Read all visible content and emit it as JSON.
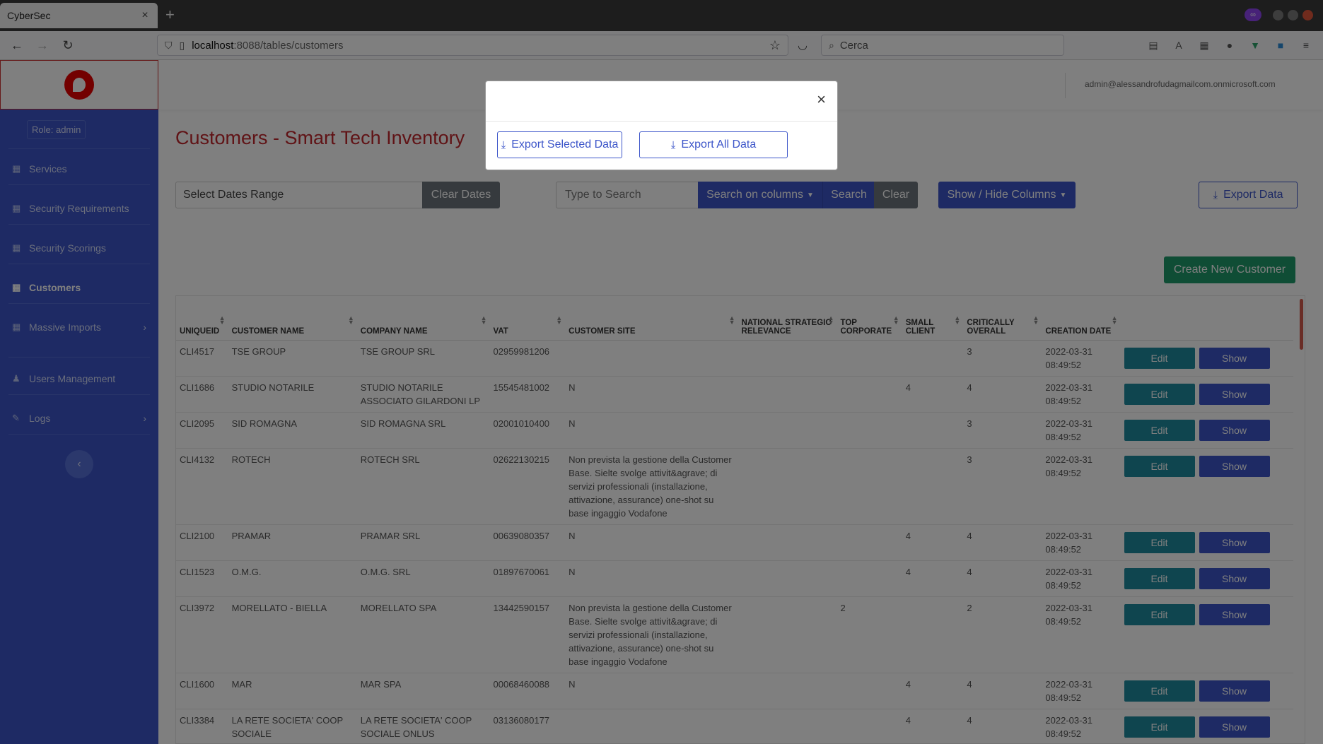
{
  "browser": {
    "tab_title": "CyberSec",
    "tab_close": "×",
    "new_tab": "+",
    "url_host": "localhost",
    "url_path": ":8088/tables/customers",
    "search_placeholder": "Cerca"
  },
  "sidebar": {
    "role": "Role: admin",
    "items": [
      {
        "label": "Services",
        "icon": "table-icon"
      },
      {
        "label": "Security Requirements",
        "icon": "table-icon"
      },
      {
        "label": "Security Scorings",
        "icon": "table-icon"
      },
      {
        "label": "Customers",
        "icon": "table-icon",
        "active": true
      },
      {
        "label": "Massive Imports",
        "icon": "table-icon",
        "chevron": "›"
      },
      {
        "label": "Users Management",
        "icon": "users-icon"
      },
      {
        "label": "Logs",
        "icon": "wrench-icon",
        "chevron": "›"
      }
    ],
    "collapse": "‹"
  },
  "topbar": {
    "user": "admin@alessandrofudagmailcom.onmicrosoft.com"
  },
  "page": {
    "title": "Customers - Smart Tech Inventory",
    "date_placeholder": "Select Dates Range",
    "clear_dates": "Clear Dates",
    "search_placeholder": "Type to Search",
    "search_columns": "Search on columns",
    "search": "Search",
    "clear": "Clear",
    "show_hide": "Show / Hide Columns",
    "export_data": "Export Data",
    "create_new": "Create New Customer"
  },
  "table": {
    "headers": [
      "UNIQUEID",
      "CUSTOMER NAME",
      "COMPANY NAME",
      "VAT",
      "CUSTOMER SITE",
      "NATIONAL STRATEGIC RELEVANCE",
      "TOP CORPORATE",
      "SMALL CLIENT",
      "CRITICALLY OVERALL",
      "CREATION DATE"
    ],
    "edit_label": "Edit",
    "show_label": "Show",
    "rows": [
      {
        "id": "CLI4517",
        "customer": "TSE GROUP",
        "company": "TSE GROUP SRL",
        "vat": "02959981206",
        "site": "",
        "nsr": "",
        "top": "",
        "small": "",
        "crit": "3",
        "date": "2022-03-31 08:49:52"
      },
      {
        "id": "CLI1686",
        "customer": "STUDIO NOTARILE",
        "company": "STUDIO NOTARILE ASSOCIATO GILARDONI LP",
        "vat": "15545481002",
        "site": "N",
        "nsr": "",
        "top": "",
        "small": "4",
        "crit": "4",
        "date": "2022-03-31 08:49:52"
      },
      {
        "id": "CLI2095",
        "customer": "SID ROMAGNA",
        "company": "SID ROMAGNA SRL",
        "vat": "02001010400",
        "site": "N",
        "nsr": "",
        "top": "",
        "small": "",
        "crit": "3",
        "date": "2022-03-31 08:49:52"
      },
      {
        "id": "CLI4132",
        "customer": "ROTECH",
        "company": "ROTECH SRL",
        "vat": "02622130215",
        "site": "Non prevista la gestione della Customer Base. Sielte svolge attivit&agrave; di servizi professionali (installazione, attivazione, assurance) one-shot su base ingaggio Vodafone",
        "nsr": "",
        "top": "",
        "small": "",
        "crit": "3",
        "date": "2022-03-31 08:49:52"
      },
      {
        "id": "CLI2100",
        "customer": "PRAMAR",
        "company": "PRAMAR SRL",
        "vat": "00639080357",
        "site": "N",
        "nsr": "",
        "top": "",
        "small": "4",
        "crit": "4",
        "date": "2022-03-31 08:49:52"
      },
      {
        "id": "CLI1523",
        "customer": "O.M.G.",
        "company": "O.M.G. SRL",
        "vat": "01897670061",
        "site": "N",
        "nsr": "",
        "top": "",
        "small": "4",
        "crit": "4",
        "date": "2022-03-31 08:49:52"
      },
      {
        "id": "CLI3972",
        "customer": "MORELLATO - BIELLA",
        "company": "MORELLATO SPA",
        "vat": "13442590157",
        "site": "Non prevista la gestione della Customer Base. Sielte svolge attivit&agrave; di servizi professionali (installazione, attivazione, assurance) one-shot su base ingaggio Vodafone",
        "nsr": "",
        "top": "2",
        "small": "",
        "crit": "2",
        "date": "2022-03-31 08:49:52"
      },
      {
        "id": "CLI1600",
        "customer": "MAR",
        "company": "MAR SPA",
        "vat": "00068460088",
        "site": "N",
        "nsr": "",
        "top": "",
        "small": "4",
        "crit": "4",
        "date": "2022-03-31 08:49:52"
      },
      {
        "id": "CLI3384",
        "customer": "LA RETE SOCIETA' COOP SOCIALE",
        "company": "LA RETE SOCIETA' COOP SOCIALE ONLUS",
        "vat": "03136080177",
        "site": "",
        "nsr": "",
        "top": "",
        "small": "4",
        "crit": "4",
        "date": "2022-03-31 08:49:52"
      }
    ]
  },
  "modal": {
    "close": "×",
    "export_selected": "Export Selected Data",
    "export_all": "Export All Data"
  }
}
